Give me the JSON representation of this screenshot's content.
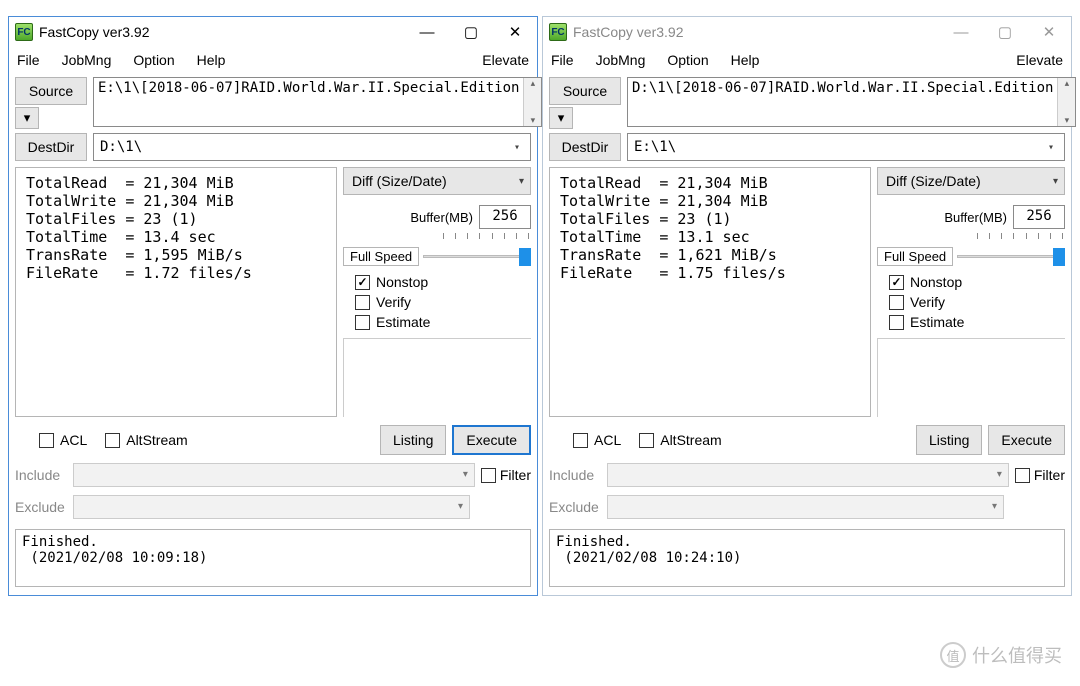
{
  "app_title": "FastCopy ver3.92",
  "menu": {
    "file": "File",
    "jobmng": "JobMng",
    "option": "Option",
    "help": "Help",
    "elevate": "Elevate"
  },
  "labels": {
    "source": "Source",
    "destdir": "DestDir",
    "diff": "Diff (Size/Date)",
    "buffer": "Buffer(MB)",
    "fullspeed": "Full Speed",
    "nonstop": "Nonstop",
    "verify": "Verify",
    "estimate": "Estimate",
    "acl": "ACL",
    "altstream": "AltStream",
    "listing": "Listing",
    "execute": "Execute",
    "include": "Include",
    "exclude": "Exclude",
    "filter": "Filter"
  },
  "left": {
    "active": true,
    "source": "E:\\1\\[2018-06-07]RAID.World.War.II.Special.Edition",
    "dest": "D:\\1\\",
    "buffer": "256",
    "stats": "TotalRead  = 21,304 MiB\nTotalWrite = 21,304 MiB\nTotalFiles = 23 (1)\nTotalTime  = 13.4 sec\nTransRate  = 1,595 MiB/s\nFileRate   = 1.72 files/s",
    "log": "Finished.\n (2021/02/08 10:09:18)"
  },
  "right": {
    "active": false,
    "source": "D:\\1\\[2018-06-07]RAID.World.War.II.Special.Edition",
    "dest": "E:\\1\\",
    "buffer": "256",
    "stats": "TotalRead  = 21,304 MiB\nTotalWrite = 21,304 MiB\nTotalFiles = 23 (1)\nTotalTime  = 13.1 sec\nTransRate  = 1,621 MiB/s\nFileRate   = 1.75 files/s",
    "log": "Finished.\n (2021/02/08 10:24:10)"
  },
  "watermark": "什么值得买"
}
